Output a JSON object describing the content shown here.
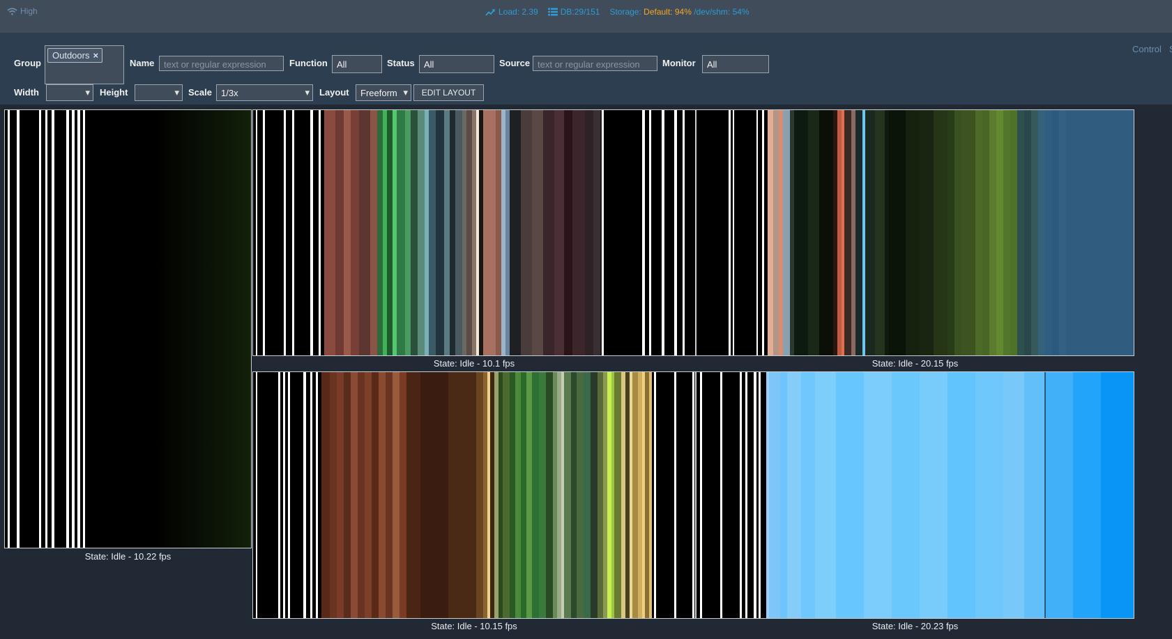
{
  "navbar": {
    "bandwidth_label": "High",
    "load_label": "Load: 2.39",
    "db_label": "DB:29/151",
    "storage_label": "Storage:",
    "storage_default": "Default: 94%",
    "storage_shm": "/dev/shm: 54%"
  },
  "filters": {
    "group_label": "Group",
    "group_chip": "Outdoors",
    "group_chip_remove": "×",
    "name_label": "Name",
    "name_placeholder": "text or regular expression",
    "function_label": "Function",
    "function_value": "All",
    "status_label": "Status",
    "status_value": "All",
    "source_label": "Source",
    "source_placeholder": "text or regular expression",
    "monitor_label": "Monitor",
    "monitor_value": "All",
    "width_label": "Width",
    "width_value": "",
    "height_label": "Height",
    "height_value": "",
    "scale_label": "Scale",
    "scale_value": "1/3x",
    "layout_label": "Layout",
    "layout_value": "Freeform",
    "edit_layout_label": "EDIT LAYOUT",
    "control_label": "Control",
    "control_suffix": "S"
  },
  "monitors": [
    {
      "caption": "State: Idle - 10.22 fps"
    },
    {
      "caption": "State: Idle - 10.1 fps"
    },
    {
      "caption": "State: Idle - 20.15 fps"
    },
    {
      "caption": "State: Idle - 10.15 fps"
    },
    {
      "caption": "State: Idle - 20.23 fps"
    }
  ],
  "colors": {
    "navbar_bg": "#404c5a",
    "filterbar_bg": "#2c3e50",
    "page_bg": "#212a34",
    "accent_blue": "#2e9bd6",
    "warning_orange": "#f5a623"
  },
  "icons": {
    "bandwidth": "wifi-icon",
    "load": "trend-up-icon",
    "db": "database-list-icon"
  }
}
